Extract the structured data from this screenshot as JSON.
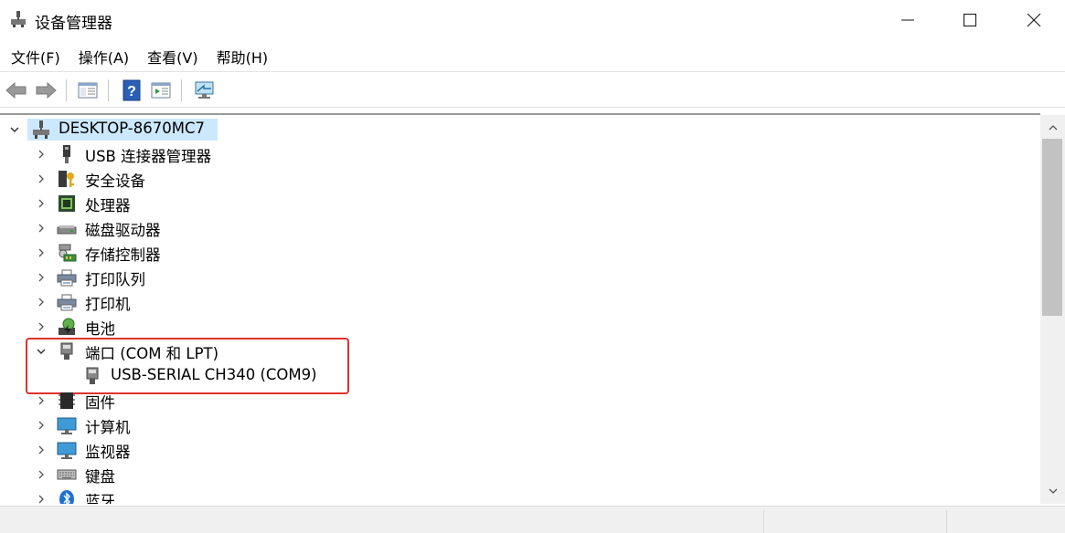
{
  "window": {
    "title": "设备管理器"
  },
  "menu": [
    {
      "label": "文件(F)"
    },
    {
      "label": "操作(A)"
    },
    {
      "label": "查看(V)"
    },
    {
      "label": "帮助(H)"
    }
  ],
  "tree": {
    "root": {
      "label": "DESKTOP-8670MC7",
      "expanded": true
    },
    "items": [
      {
        "label": "USB 连接器管理器",
        "icon": "usb-connector-icon"
      },
      {
        "label": "安全设备",
        "icon": "security-key-icon"
      },
      {
        "label": "处理器",
        "icon": "processor-icon"
      },
      {
        "label": "磁盘驱动器",
        "icon": "disk-drive-icon"
      },
      {
        "label": "存储控制器",
        "icon": "storage-controller-icon"
      },
      {
        "label": "打印队列",
        "icon": "print-queue-icon"
      },
      {
        "label": "打印机",
        "icon": "printer-icon"
      },
      {
        "label": "电池",
        "icon": "battery-icon"
      },
      {
        "label": "端口 (COM 和 LPT)",
        "icon": "port-icon",
        "expanded": true,
        "children": [
          {
            "label": "USB-SERIAL CH340 (COM9)",
            "icon": "serial-port-icon"
          }
        ]
      },
      {
        "label": "固件",
        "icon": "firmware-icon"
      },
      {
        "label": "计算机",
        "icon": "computer-icon"
      },
      {
        "label": "监视器",
        "icon": "monitor-icon"
      },
      {
        "label": "键盘",
        "icon": "keyboard-icon"
      },
      {
        "label": "蓝牙",
        "icon": "bluetooth-icon"
      }
    ]
  },
  "colors": {
    "selection": "#cce8ff",
    "highlight_border": "#e0312e"
  }
}
